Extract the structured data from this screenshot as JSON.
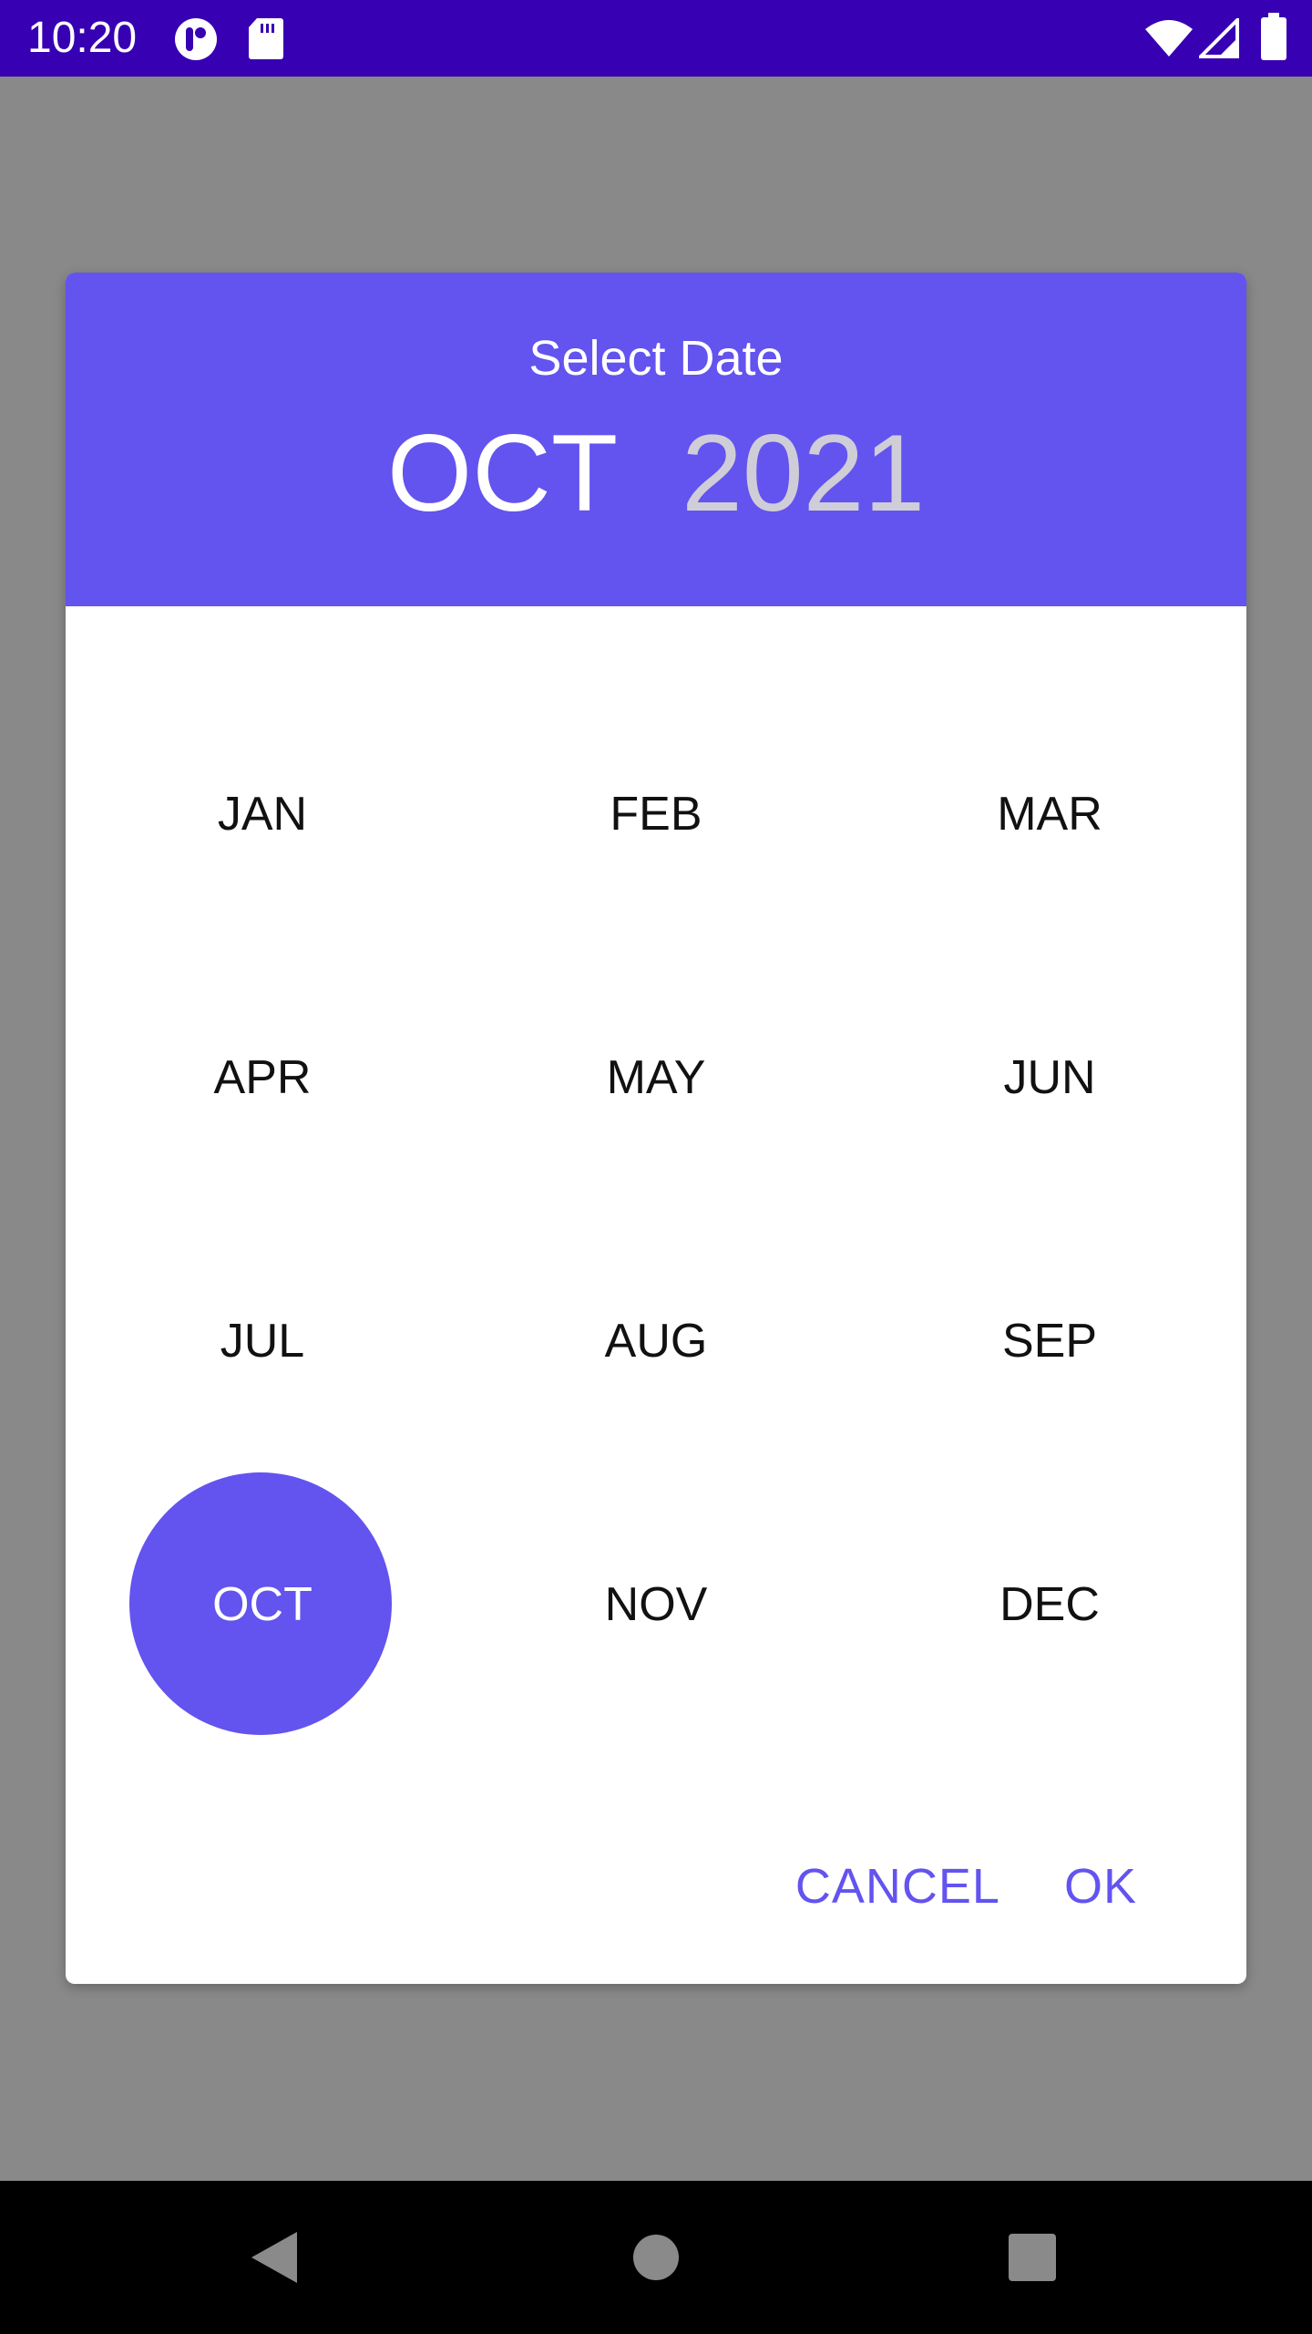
{
  "status_bar": {
    "time": "10:20",
    "icons": [
      "app-notification-icon",
      "sd-card-icon",
      "wifi-icon",
      "signal-icon",
      "battery-icon"
    ]
  },
  "dialog": {
    "title": "Select Date",
    "selected_month": "OCT",
    "selected_year": "2021",
    "months": [
      "JAN",
      "FEB",
      "MAR",
      "APR",
      "MAY",
      "JUN",
      "JUL",
      "AUG",
      "SEP",
      "OCT",
      "NOV",
      "DEC"
    ],
    "cancel_label": "CANCEL",
    "ok_label": "OK"
  },
  "colors": {
    "status_bar": "#3700b3",
    "accent": "#6353ef",
    "scrim": "#898989"
  },
  "nav_bar": {
    "icons": [
      "back-icon",
      "home-icon",
      "recents-icon"
    ]
  }
}
